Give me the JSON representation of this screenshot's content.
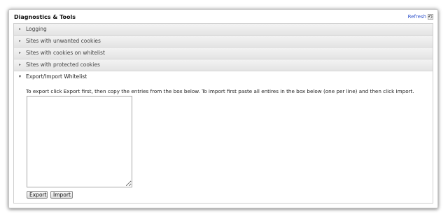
{
  "panel": {
    "title": "Diagnostics & Tools",
    "refresh_label": "Refresh"
  },
  "icons": {
    "refresh": "refresh-icon",
    "collapsed_arrow": "triangle-right",
    "expanded_arrow": "triangle-down"
  },
  "sections": [
    {
      "label": "Logging",
      "expanded": false
    },
    {
      "label": "Sites with unwanted cookies",
      "expanded": false
    },
    {
      "label": "Sites with cookies on whitelist",
      "expanded": false
    },
    {
      "label": "Sites with protected cookies",
      "expanded": false
    },
    {
      "label": "Export/Import Whitelist",
      "expanded": true
    }
  ],
  "export_import": {
    "instructions": "To export click Export first, then copy the entries from the box below. To import first paste all entires in the box below (one per line) and then click Import.",
    "whitelist_value": "",
    "export_label": "Export",
    "import_label": "Import"
  },
  "colors": {
    "link": "#3355cc",
    "row_bg": "#e9e9e9",
    "border": "#cfcfcf"
  }
}
